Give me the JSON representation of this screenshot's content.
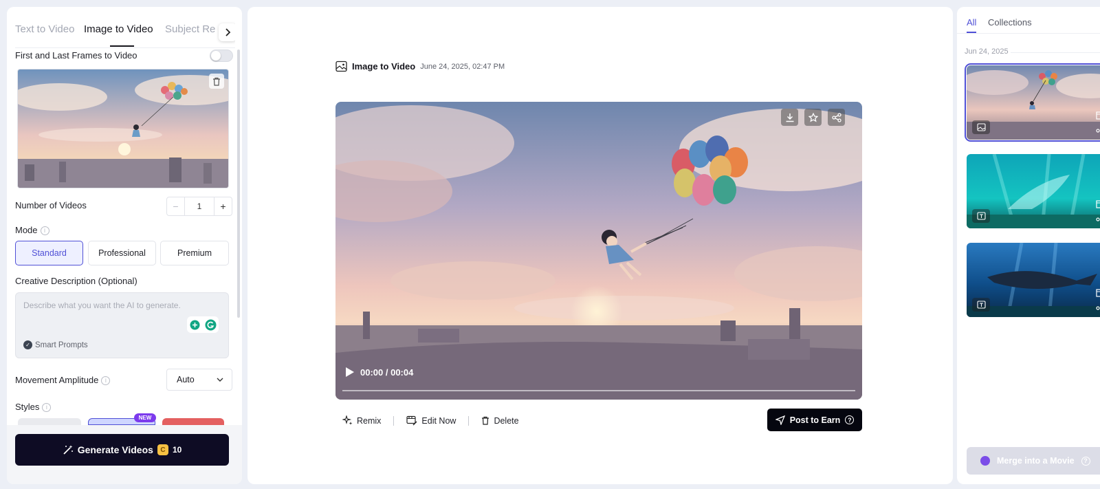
{
  "tabs": {
    "items": [
      "Text to Video",
      "Image to Video",
      "Subject Re"
    ],
    "active": 1
  },
  "left": {
    "first_last_label": "First and Last Frames to Video",
    "num_videos_label": "Number of Videos",
    "num_videos_value": "1",
    "minus": "−",
    "plus": "+",
    "mode_label": "Mode",
    "info_glyph": "i",
    "modes": [
      "Standard",
      "Professional",
      "Premium"
    ],
    "selected_mode": "Standard",
    "desc_label": "Creative Description (Optional)",
    "desc_placeholder": "Describe what you want the AI to generate.",
    "smart_prompts": "Smart Prompts",
    "amplitude_label": "Movement Amplitude",
    "amplitude_value": "Auto",
    "styles_label": "Styles",
    "new_badge": "NEW",
    "generate_label": "Generate Videos",
    "coin_glyph": "C",
    "generate_cost": "10"
  },
  "center": {
    "header_title": "Image to Video",
    "header_date": "June 24, 2025, 02:47 PM",
    "time_display": "00:00 / 00:04",
    "actions": [
      "Remix",
      "Edit Now",
      "Delete"
    ],
    "post_label": "Post to Earn",
    "post_help": "?"
  },
  "right": {
    "tabs": [
      "All",
      "Collections"
    ],
    "date_group": "Jun 24, 2025",
    "merge_label": "Merge into a Movie",
    "merge_help": "?"
  },
  "colors": {
    "accent": "#4f4fd6",
    "generate_bg": "#0e0c24",
    "post_bg": "#05060f",
    "new_badge": "#7c3aed"
  }
}
